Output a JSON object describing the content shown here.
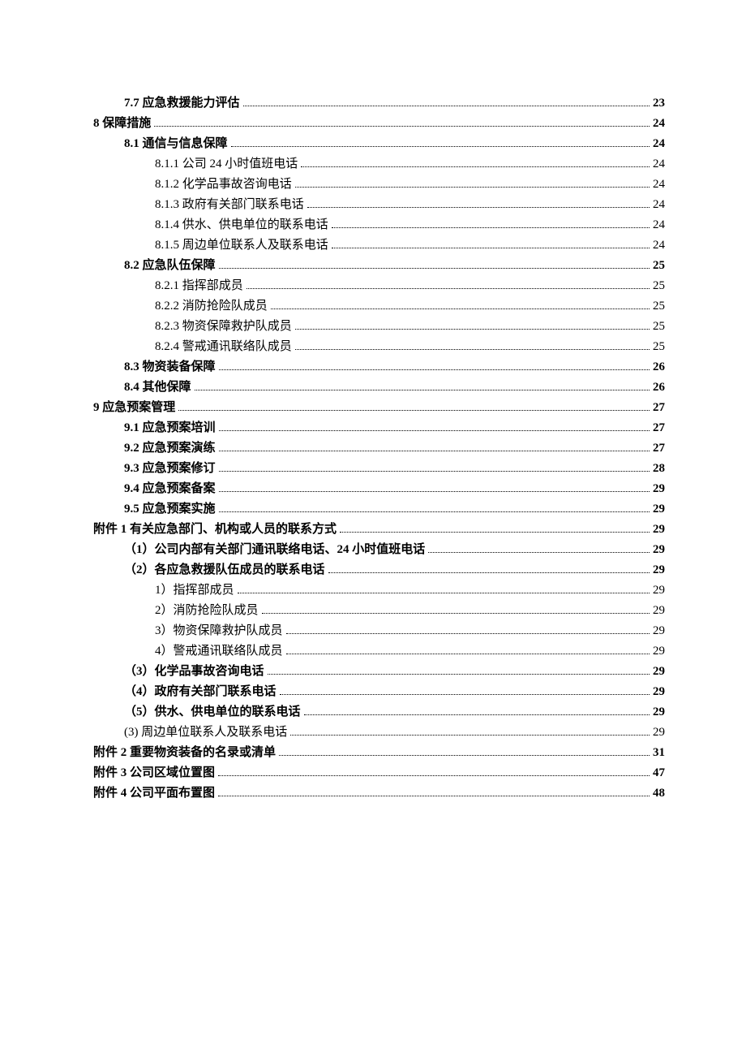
{
  "toc": [
    {
      "level": 2,
      "title": "7.7 应急救援能力评估",
      "page": "23",
      "bold": true
    },
    {
      "level": 1,
      "title": "8 保障措施",
      "page": "24",
      "bold": true
    },
    {
      "level": 2,
      "title": "8.1 通信与信息保障",
      "page": "24",
      "bold": true
    },
    {
      "level": 3,
      "title": "8.1.1 公司 24 小时值班电话",
      "page": "24",
      "bold": false
    },
    {
      "level": 3,
      "title": "8.1.2 化学品事故咨询电话",
      "page": "24",
      "bold": false
    },
    {
      "level": 3,
      "title": "8.1.3 政府有关部门联系电话",
      "page": "24",
      "bold": false
    },
    {
      "level": 3,
      "title": "8.1.4 供水、供电单位的联系电话",
      "page": "24",
      "bold": false
    },
    {
      "level": 3,
      "title": "8.1.5 周边单位联系人及联系电话",
      "page": "24",
      "bold": false
    },
    {
      "level": 2,
      "title": "8.2 应急队伍保障",
      "page": "25",
      "bold": true
    },
    {
      "level": 3,
      "title": "8.2.1 指挥部成员",
      "page": "25",
      "bold": false
    },
    {
      "level": 3,
      "title": "8.2.2 消防抢险队成员",
      "page": "25",
      "bold": false
    },
    {
      "level": 3,
      "title": "8.2.3 物资保障救护队成员",
      "page": "25",
      "bold": false
    },
    {
      "level": 3,
      "title": "8.2.4 警戒通讯联络队成员",
      "page": "25",
      "bold": false
    },
    {
      "level": 2,
      "title": "8.3  物资装备保障",
      "page": "26",
      "bold": true
    },
    {
      "level": 2,
      "title": "8.4 其他保障",
      "page": "26",
      "bold": true
    },
    {
      "level": 1,
      "title": "9 应急预案管理",
      "page": "27",
      "bold": true
    },
    {
      "level": 2,
      "title": "9.1 应急预案培训",
      "page": "27",
      "bold": true
    },
    {
      "level": 2,
      "title": "9.2 应急预案演练",
      "page": "27",
      "bold": true
    },
    {
      "level": 2,
      "title": "9.3 应急预案修订",
      "page": "28",
      "bold": true
    },
    {
      "level": 2,
      "title": "9.4 应急预案备案",
      "page": "29",
      "bold": true
    },
    {
      "level": 2,
      "title": "9.5 应急预案实施",
      "page": "29",
      "bold": true
    },
    {
      "level": 1,
      "title": "附件 1 有关应急部门、机构或人员的联系方式",
      "page": "29",
      "bold": true
    },
    {
      "level": 2,
      "title": "（1）公司内部有关部门通讯联络电话、24 小时值班电话",
      "page": "29",
      "bold": true
    },
    {
      "level": 2,
      "title": "（2）各应急救援队伍成员的联系电话",
      "page": "29",
      "bold": true
    },
    {
      "level": 3,
      "title": "1）指挥部成员",
      "page": "29",
      "bold": false
    },
    {
      "level": 3,
      "title": "2）消防抢险队成员",
      "page": "29",
      "bold": false
    },
    {
      "level": 3,
      "title": "3）物资保障救护队成员",
      "page": "29",
      "bold": false
    },
    {
      "level": 3,
      "title": "4）警戒通讯联络队成员",
      "page": "29",
      "bold": false
    },
    {
      "level": 2,
      "title": "（3）化学品事故咨询电话",
      "page": "29",
      "bold": true
    },
    {
      "level": 2,
      "title": "（4）政府有关部门联系电话",
      "page": "29",
      "bold": true
    },
    {
      "level": 2,
      "title": "（5）供水、供电单位的联系电话",
      "page": "29",
      "bold": true
    },
    {
      "level": 2,
      "title": "(3)  周边单位联系人及联系电话",
      "page": "29",
      "bold": false
    },
    {
      "level": 1,
      "title": "附件 2 重要物资装备的名录或清单",
      "page": "31",
      "bold": true
    },
    {
      "level": 1,
      "title": "附件 3 公司区域位置图",
      "page": "47",
      "bold": true
    },
    {
      "level": 1,
      "title": "附件 4 公司平面布置图",
      "page": "48",
      "bold": true
    }
  ]
}
